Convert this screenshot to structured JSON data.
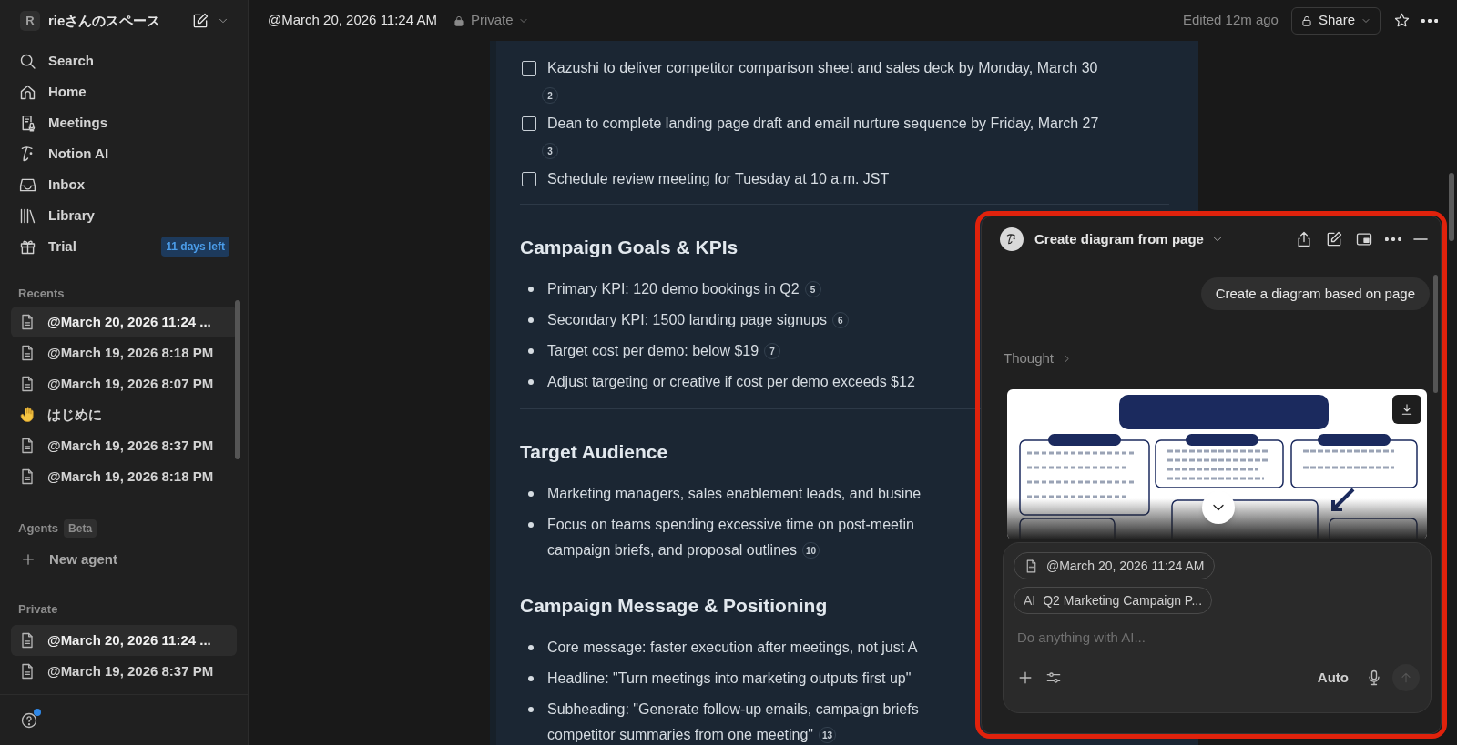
{
  "workspace": {
    "initial": "R",
    "name": "rieさんのスペース"
  },
  "nav": [
    {
      "label": "Search"
    },
    {
      "label": "Home"
    },
    {
      "label": "Meetings"
    },
    {
      "label": "Notion AI"
    },
    {
      "label": "Inbox"
    },
    {
      "label": "Library"
    },
    {
      "label": "Trial",
      "badge": "11 days left"
    }
  ],
  "recents": {
    "title": "Recents",
    "items": [
      {
        "kind": "page",
        "label": "@March 20, 2026 11:24 ...",
        "selected": true
      },
      {
        "kind": "page",
        "label": "@March 19, 2026 8:18 PM",
        "selected": false
      },
      {
        "kind": "page",
        "label": "@March 19, 2026 8:07 PM",
        "selected": false
      },
      {
        "kind": "hand",
        "label": "はじめに",
        "selected": false
      },
      {
        "kind": "page",
        "label": "@March 19, 2026 8:37 PM",
        "selected": false
      },
      {
        "kind": "page",
        "label": "@March 19, 2026 8:18 PM",
        "selected": false
      }
    ]
  },
  "agents": {
    "title": "Agents",
    "badge": "Beta",
    "action": "New agent"
  },
  "private": {
    "title": "Private",
    "items": [
      {
        "kind": "page",
        "label": "@March 20, 2026 11:24 ...",
        "selected": true
      },
      {
        "kind": "page",
        "label": "@March 19, 2026 8:37 PM",
        "selected": false
      }
    ]
  },
  "topbar": {
    "title": "@March 20, 2026 11:24 AM",
    "privacy": "Private",
    "edited": "Edited 12m ago",
    "share": "Share"
  },
  "document": {
    "blocks": [
      {
        "kind": "todo",
        "text": "Kazushi to deliver competitor comparison sheet and sales deck by Monday, March 30",
        "checked": false,
        "ref": "2"
      },
      {
        "kind": "todo",
        "text": "Dean to complete landing page draft and email nurture sequence by Friday, March 27",
        "checked": false,
        "ref": "3"
      },
      {
        "kind": "todo",
        "text": "Schedule review meeting for Tuesday at 10 a.m. JST",
        "checked": false
      },
      {
        "kind": "divider"
      },
      {
        "kind": "heading",
        "text": "Campaign Goals & KPIs"
      },
      {
        "kind": "bullet",
        "lines": [
          "Primary KPI: 120 demo bookings in Q2"
        ],
        "ref": "5"
      },
      {
        "kind": "bullet",
        "lines": [
          "Secondary KPI: 1500 landing page signups"
        ],
        "ref": "6"
      },
      {
        "kind": "bullet",
        "lines": [
          "Target cost per demo: below $19"
        ],
        "ref": "7"
      },
      {
        "kind": "bullet",
        "lines": [
          "Adjust targeting or creative if cost per demo exceeds $12"
        ]
      },
      {
        "kind": "divider"
      },
      {
        "kind": "heading",
        "text": "Target Audience"
      },
      {
        "kind": "bullet",
        "lines": [
          "Marketing managers, sales enablement leads, and busine"
        ]
      },
      {
        "kind": "bullet",
        "lines": [
          "Focus on teams spending excessive time on post-meetin",
          "campaign briefs, and proposal outlines"
        ],
        "ref": "10"
      },
      {
        "kind": "heading",
        "text": "Campaign Message & Positioning"
      },
      {
        "kind": "bullet",
        "lines": [
          "Core message: faster execution after meetings, not just A"
        ]
      },
      {
        "kind": "bullet",
        "lines": [
          "Headline: \"Turn meetings into marketing outputs first up\""
        ]
      },
      {
        "kind": "bullet",
        "lines": [
          "Subheading: \"Generate follow-up emails, campaign briefs",
          "competitor summaries from one meeting\""
        ],
        "ref": "13"
      }
    ]
  },
  "ai_panel": {
    "title": "Create diagram from page",
    "user_message": "Create a diagram based on page",
    "thought": "Thought",
    "chips": [
      {
        "kind": "page",
        "label": "@March 20, 2026 11:24 AM"
      },
      {
        "kind": "text",
        "prefix": "AI",
        "label": "Q2 Marketing Campaign P..."
      }
    ],
    "input": {
      "placeholder": "Do anything with AI..."
    },
    "mode": "Auto"
  }
}
